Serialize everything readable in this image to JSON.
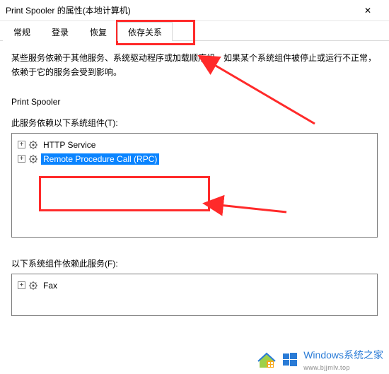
{
  "window": {
    "title": "Print Spooler 的属性(本地计算机)",
    "close_glyph": "✕"
  },
  "tabs": {
    "t0": "常规",
    "t1": "登录",
    "t2": "恢复",
    "t3": "依存关系"
  },
  "description": "某些服务依赖于其他服务、系统驱动程序或加载顺序组。如果某个系统组件被停止或运行不正常，依赖于它的服务会受到影响。",
  "service_name_label": "Print Spooler",
  "depends_on_label": "此服务依赖以下系统组件(T):",
  "dependents_label": "以下系统组件依赖此服务(F):",
  "tree_depends": {
    "n0": "HTTP Service",
    "n1": "Remote Procedure Call (RPC)"
  },
  "tree_dependents": {
    "n0": "Fax"
  },
  "watermark": {
    "brand": "Windows",
    "brand_cn": "系统之家",
    "url": "www.bjjmlv.top"
  },
  "colors": {
    "selection": "#0a84ff",
    "annotation": "#ff2a2a",
    "wm_brand": "#2a7bd6"
  }
}
